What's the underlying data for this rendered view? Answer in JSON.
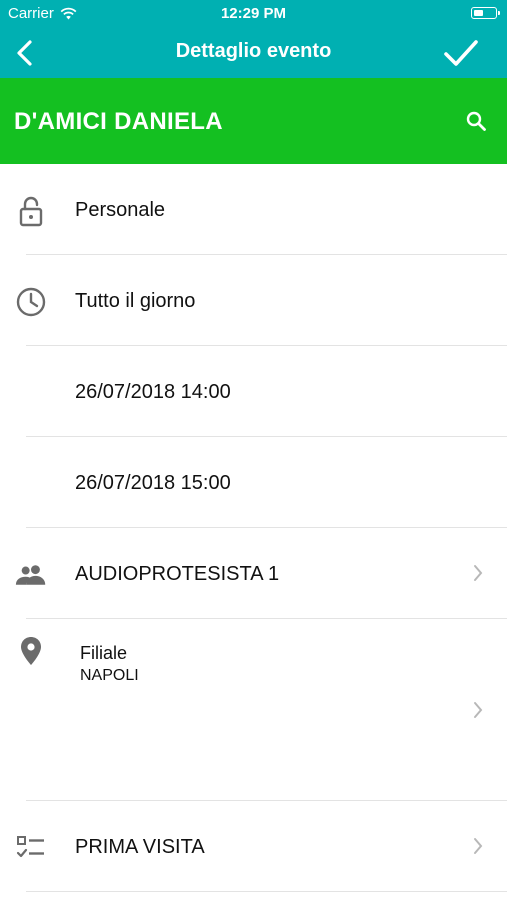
{
  "status_bar": {
    "carrier": "Carrier",
    "time": "12:29 PM",
    "battery_level": 0.45
  },
  "nav": {
    "title": "Dettaglio evento",
    "back_icon": "chevron-left-icon",
    "confirm_icon": "checkmark-icon"
  },
  "banner": {
    "name": "D'AMICI DANIELA",
    "search_icon": "search-icon"
  },
  "colors": {
    "nav_bg": "#00b0b2",
    "banner_bg": "#14c021",
    "icon_gray": "#6b6b6b",
    "separator": "#e3e3e3"
  },
  "rows": {
    "privacy": {
      "icon": "lock-icon",
      "label": "Personale"
    },
    "allday": {
      "icon": "clock-icon",
      "label": "Tutto il giorno"
    },
    "start": {
      "label": "26/07/2018 14:00"
    },
    "end": {
      "label": "26/07/2018 15:00"
    },
    "operator": {
      "icon": "people-icon",
      "label": "AUDIOPROTESISTA 1"
    },
    "location": {
      "icon": "location-pin-icon",
      "title": "Filiale",
      "value": "NAPOLI"
    },
    "type": {
      "icon": "checklist-icon",
      "label": "PRIMA VISITA"
    }
  }
}
